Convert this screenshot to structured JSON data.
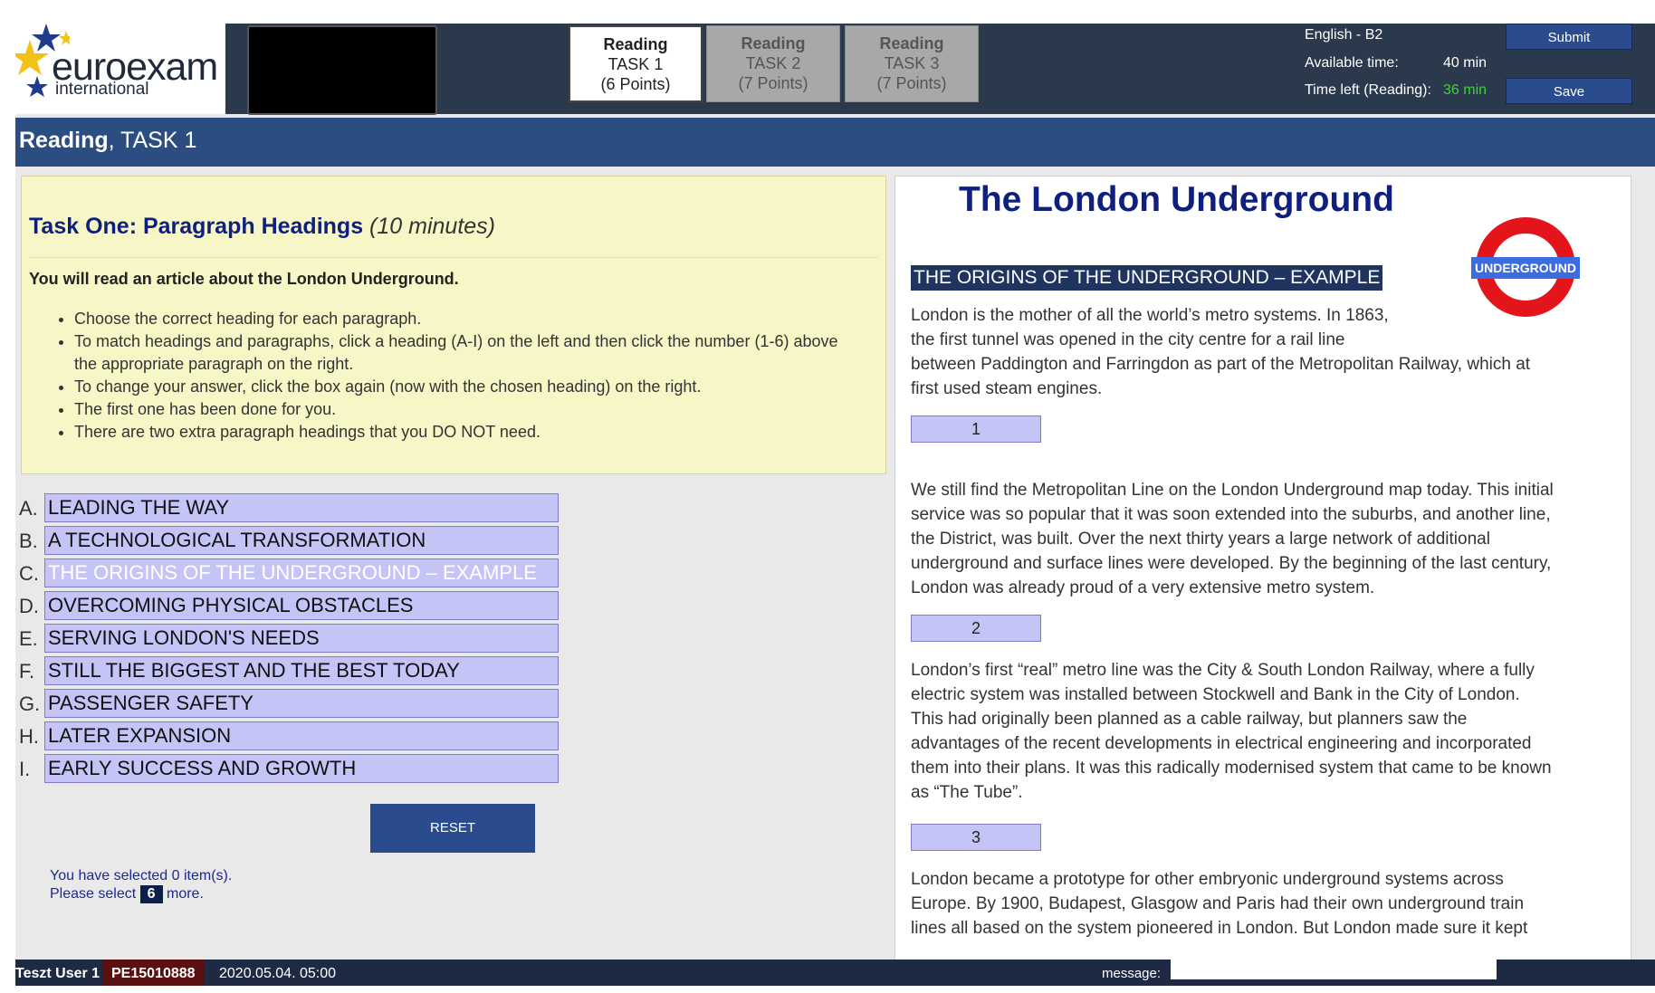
{
  "header": {
    "logo_brand": "euroexam",
    "logo_sub": "international",
    "tabs": [
      {
        "title": "Reading",
        "task": "TASK 1",
        "points": "(6 Points)"
      },
      {
        "title": "Reading",
        "task": "TASK 2",
        "points": "(7 Points)"
      },
      {
        "title": "Reading",
        "task": "TASK 3",
        "points": "(7 Points)"
      }
    ],
    "level": "English - B2",
    "available_label": "Available time:",
    "available_value": "40 min",
    "left_label": "Time left (Reading):",
    "left_value": "36 min",
    "submit_label": "Submit",
    "save_label": "Save",
    "accent_time_color": "#3bd13b"
  },
  "titlebar": {
    "bold": "Reading",
    "rest": ", TASK 1"
  },
  "instructions": {
    "heading": "Task One: Paragraph Headings",
    "duration": "(10 minutes)",
    "lead": "You will read an article about the London Underground.",
    "bullets": [
      "Choose the correct heading for each paragraph.",
      "To match headings and paragraphs, click a heading (A-I) on the left and then click the number (1-6) above the appropriate paragraph on the right.",
      "To change your answer, click the box again (now with the chosen heading) on the right.",
      "The first one has been done for you.",
      "There are two extra paragraph headings that you DO NOT need."
    ]
  },
  "headings": [
    {
      "letter": "A.",
      "text": "LEADING THE WAY"
    },
    {
      "letter": "B.",
      "text": "A TECHNOLOGICAL TRANSFORMATION"
    },
    {
      "letter": "C.",
      "text": "THE ORIGINS OF THE UNDERGROUND – EXAMPLE"
    },
    {
      "letter": "D.",
      "text": "OVERCOMING PHYSICAL OBSTACLES"
    },
    {
      "letter": "E.",
      "text": "SERVING LONDON'S NEEDS"
    },
    {
      "letter": "F.",
      "text": "STILL THE BIGGEST AND THE BEST TODAY"
    },
    {
      "letter": "G.",
      "text": "PASSENGER SAFETY"
    },
    {
      "letter": "H.",
      "text": "LATER EXPANSION"
    },
    {
      "letter": "I.",
      "text": "EARLY SUCCESS AND GROWTH"
    }
  ],
  "reset_label": "RESET",
  "selection": {
    "line1": "You have selected 0 item(s).",
    "pre": "Please select",
    "count": "6",
    "post": "more."
  },
  "article": {
    "title": "The London Underground",
    "roundel_text": "UNDERGROUND",
    "example_heading": "THE ORIGINS OF THE UNDERGROUND – EXAMPLE",
    "p0": [
      "London is the mother of all the world’s metro systems. In 1863,",
      "the first tunnel was opened in the city centre for a rail line",
      "between Paddington and Farringdon as part of the Metropolitan Railway, which at",
      "first used steam engines."
    ],
    "p1": [
      "We still find the Metropolitan Line on the London Underground map today. This initial",
      "service was so popular that it was soon extended into the suburbs, and another line,",
      "the District, was built. Over the next thirty years a large network of additional",
      "underground and surface lines were developed. By the beginning of the last century,",
      "London was already proud of a very extensive metro system."
    ],
    "p2": [
      "London’s first “real” metro line was the City & South London Railway, where a fully",
      "electric system was installed between Stockwell and Bank in the City of London.",
      "This had originally been planned as a cable railway, but planners saw the",
      "advantages of the recent developments in electrical engineering and incorporated",
      "them into their plans. It was this radically modernised system that came to be known",
      "as “The Tube”."
    ],
    "p3": [
      "London became a prototype for other embryonic underground systems across",
      "Europe. By 1900, Budapest, Glasgow and Paris had their own underground train",
      "lines all based on the system pioneered in London. But London made sure it kept"
    ],
    "answers": [
      "1",
      "2",
      "3"
    ]
  },
  "footer": {
    "user": "Teszt User 1",
    "code": "PE15010888",
    "date": "2020.05.04. 05:00",
    "message_label": "message:"
  }
}
